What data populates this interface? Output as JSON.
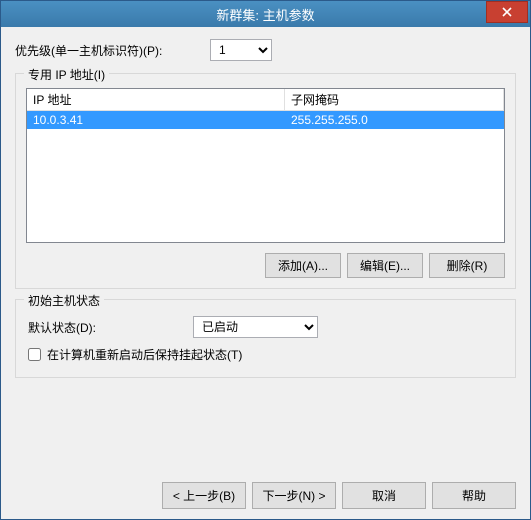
{
  "titlebar": {
    "text": "新群集: 主机参数"
  },
  "priority": {
    "label": "优先级(单一主机标识符)(P):",
    "value": "1"
  },
  "ip_group": {
    "legend": "专用 IP 地址(I)",
    "col_ip": "IP 地址",
    "col_mask": "子网掩码",
    "rows": [
      {
        "ip": "10.0.3.41",
        "mask": "255.255.255.0"
      }
    ],
    "buttons": {
      "add": "添加(A)...",
      "edit": "编辑(E)...",
      "remove": "删除(R)"
    }
  },
  "state_group": {
    "legend": "初始主机状态",
    "default_state_label": "默认状态(D):",
    "default_state_value": "已启动",
    "retain_label": "在计算机重新启动后保持挂起状态(T)"
  },
  "nav": {
    "back": "< 上一步(B)",
    "next": "下一步(N) >",
    "cancel": "取消",
    "help": "帮助"
  }
}
